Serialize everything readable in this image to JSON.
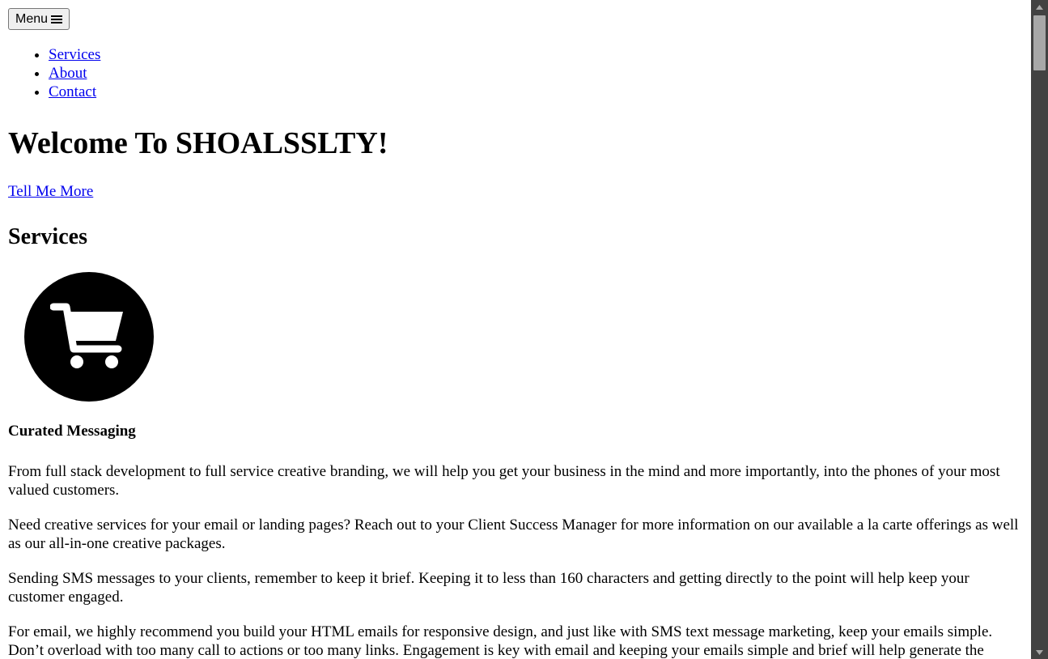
{
  "header": {
    "menu_label": "Menu"
  },
  "nav": {
    "items": [
      {
        "label": "Services"
      },
      {
        "label": "About"
      },
      {
        "label": "Contact"
      }
    ]
  },
  "hero": {
    "title": "Welcome To SHOALSSLTY!",
    "cta_label": "Tell Me More"
  },
  "services": {
    "heading": "Services",
    "icon": "shopping-cart-icon",
    "card_title": "Curated Messaging",
    "paragraphs": [
      "From full stack development to full service creative branding, we will help you get your business in the mind and more importantly, into the phones of your most valued customers.",
      "Need creative services for your email or landing pages? Reach out to your Client Success Manager for more information on our available a la carte offerings as well as our all-in-one creative packages.",
      "Sending SMS messages to your clients, remember to keep it brief. Keeping it to less than 160 characters and getting directly to the point will help keep your customer engaged.",
      "For email, we highly recommend you build your HTML emails for responsive design, and just like with SMS text message marketing, keep your emails simple. Don’t overload with too many call to actions or too many links. Engagement is key with email and keeping your emails simple and brief will help generate the"
    ]
  },
  "colors": {
    "link": "#0000ee",
    "icon_circle": "#000000",
    "scrollbar_track": "#424242",
    "scrollbar_thumb": "#a8a8a8"
  }
}
